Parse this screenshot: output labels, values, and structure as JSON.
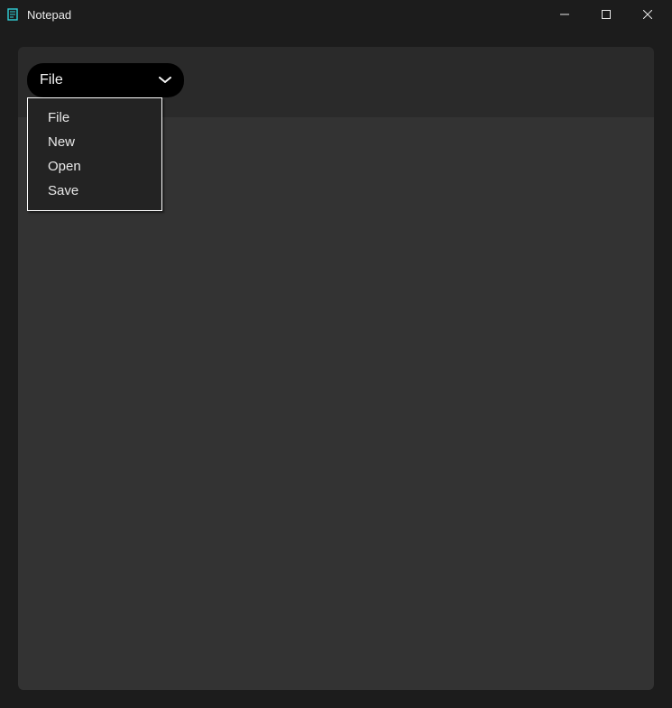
{
  "window": {
    "title": "Notepad"
  },
  "toolbar": {
    "file_button_label": "File"
  },
  "menu": {
    "items": [
      {
        "label": "File"
      },
      {
        "label": "New"
      },
      {
        "label": "Open"
      },
      {
        "label": "Save"
      }
    ]
  }
}
